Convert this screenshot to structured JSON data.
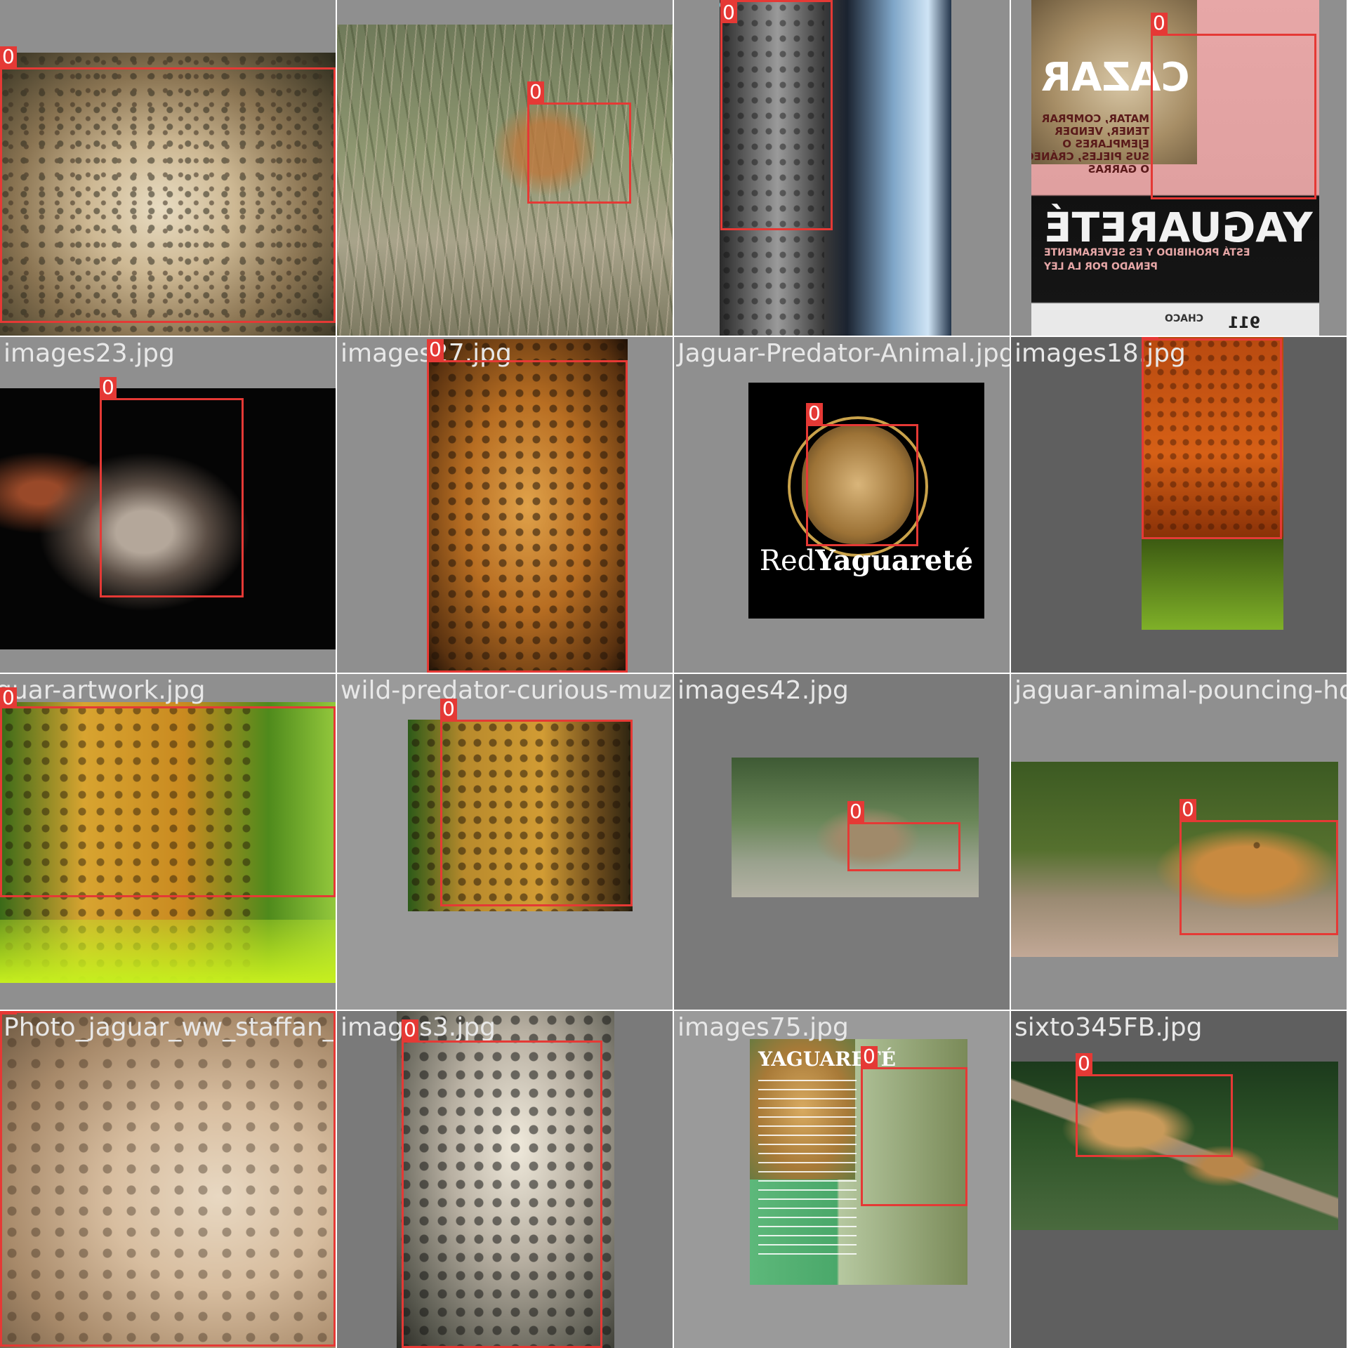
{
  "grid": {
    "tiles": [
      {
        "filename": "",
        "class_label": "0",
        "cell_bg": "#8f8f8f"
      },
      {
        "filename": "",
        "class_label": "0",
        "cell_bg": "#8f8f8f"
      },
      {
        "filename": "",
        "class_label": "0",
        "cell_bg": "#8f8f8f"
      },
      {
        "filename": "",
        "class_label": "0",
        "cell_bg": "#8f8f8f",
        "poster_lines": [
          "CAZAR",
          "MATAR, COMPRAR",
          "TENER, VENDER",
          "EJEMPLARES O",
          "SUS PIELES, CRÁNEOS",
          "O GARRAS",
          "YAGUARETÉ",
          "ESTÁ PROHIBIDO Y ES SEVERAMENTE",
          "PENADO POR LA LEY",
          "CHACO",
          "911"
        ]
      },
      {
        "filename": "images23.jpg",
        "class_label": "0",
        "cell_bg": "#8f8f8f"
      },
      {
        "filename": "images27.jpg",
        "class_label": "0",
        "cell_bg": "#8f8f8f"
      },
      {
        "filename": "Jaguar-Predator-Animal.jpg",
        "class_label": "0",
        "cell_bg": "#8f8f8f",
        "logo_text_1": "Red",
        "logo_text_2": "Yaguareté"
      },
      {
        "filename": "images18.jpg",
        "class_label": "0",
        "cell_bg": "#5f5f5f"
      },
      {
        "filename": "jaguar-artwork.jpg",
        "class_label": "0",
        "cell_bg": "#8f8f8f"
      },
      {
        "filename": "wild-predator-curious-muzzle-jaguar-anim",
        "class_label": "0",
        "cell_bg": "#9a9a9a"
      },
      {
        "filename": "images42.jpg",
        "class_label": "0",
        "cell_bg": "#7a7a7a"
      },
      {
        "filename": "jaguar-animal-pouncing-hd_",
        "class_label": "0",
        "cell_bg": "#8f8f8f"
      },
      {
        "filename": "Photo_jaguar_ww_staffan_widstrand.jpg",
        "class_label": "0",
        "cell_bg": "#8f8f8f"
      },
      {
        "filename": "images3.jpg",
        "class_label": "0",
        "cell_bg": "#7a7a7a"
      },
      {
        "filename": "images75.jpg",
        "class_label": "0",
        "cell_bg": "#9a9a9a",
        "card_title": "YAGUARETÉ"
      },
      {
        "filename": "sixto345FB.jpg",
        "class_label": "0",
        "cell_bg": "#5f5f5f"
      }
    ]
  },
  "colors": {
    "box": "#e53935",
    "filename_text": "#e8e8e8",
    "cell_border": "#ffffff"
  }
}
